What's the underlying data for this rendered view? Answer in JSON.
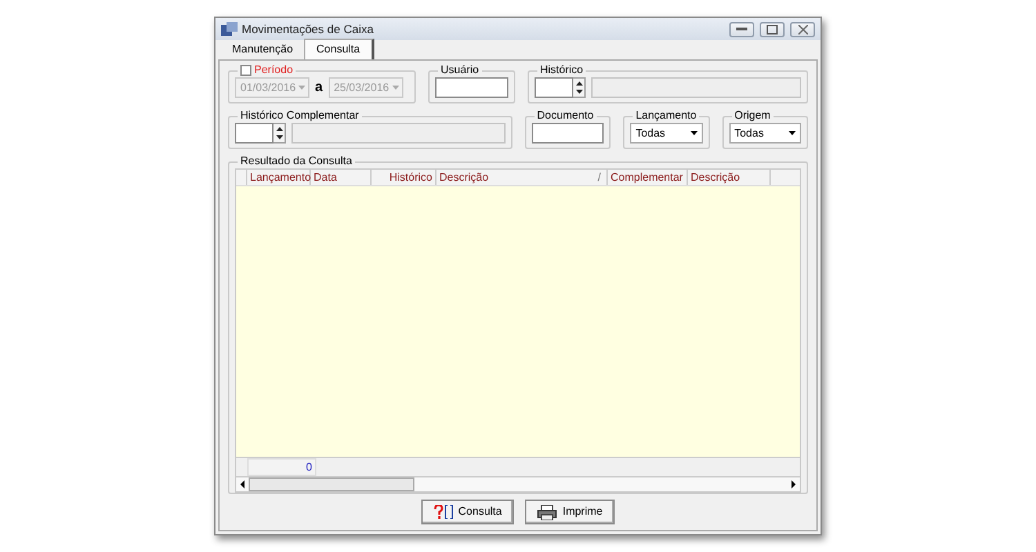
{
  "window": {
    "title": "Movimentações de Caixa"
  },
  "tabs": [
    {
      "label": "Manutenção",
      "selected": false
    },
    {
      "label": "Consulta",
      "selected": true
    }
  ],
  "filters": {
    "periodo": {
      "label": "Período",
      "checked": false,
      "from": "01/03/2016",
      "separator": "a",
      "to": "25/03/2016"
    },
    "usuario": {
      "label": "Usuário"
    },
    "historico": {
      "label": "Histórico"
    },
    "historico_complementar": {
      "label": "Histórico Complementar"
    },
    "documento": {
      "label": "Documento"
    },
    "lancamento": {
      "label": "Lançamento",
      "value": "Todas"
    },
    "origem": {
      "label": "Origem",
      "value": "Todas"
    }
  },
  "results": {
    "title": "Resultado da Consulta",
    "columns": [
      {
        "label": "Lançamento"
      },
      {
        "label": "Data"
      },
      {
        "label": "Histórico"
      },
      {
        "label": "Descrição",
        "sort_mark": "/"
      },
      {
        "label": "Complementar"
      },
      {
        "label": "Descrição"
      }
    ],
    "footer_count": "0"
  },
  "buttons": [
    {
      "label": "Consulta",
      "kind": "query"
    },
    {
      "label": "Imprime",
      "kind": "print"
    }
  ]
}
